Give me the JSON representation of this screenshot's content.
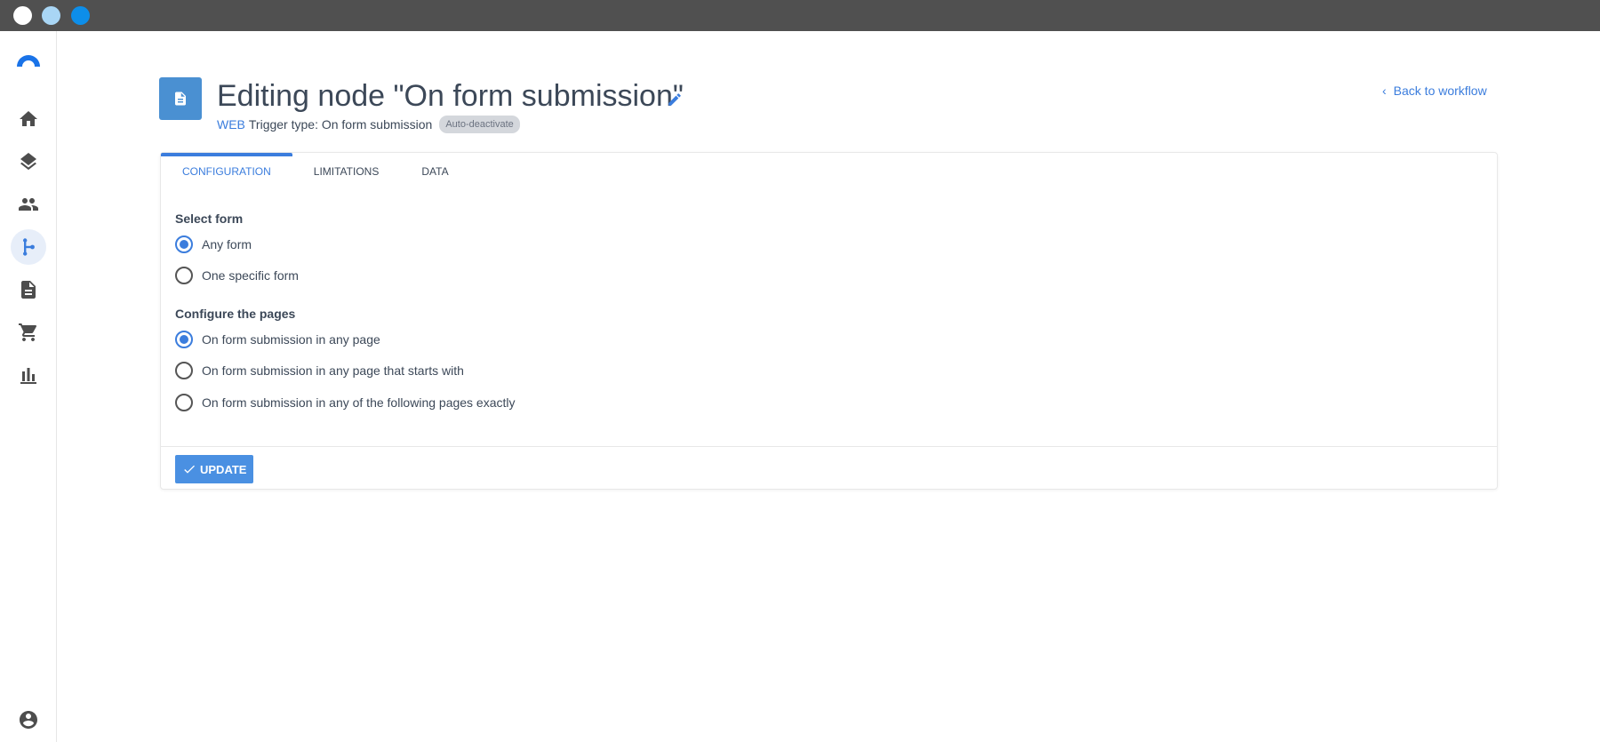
{
  "colors": {
    "titlebar": "#505050",
    "traffic_1": "#ffffff",
    "traffic_2": "#a9d6f5",
    "traffic_3": "#0d8ee9",
    "accent": "#3b7ddd",
    "node_icon_bg": "#4a90d2",
    "button_bg": "#4a90e2"
  },
  "sidebar": {
    "logo": "app-logo",
    "items": [
      {
        "icon": "home-icon",
        "active": false
      },
      {
        "icon": "layers-icon",
        "active": false
      },
      {
        "icon": "people-icon",
        "active": false
      },
      {
        "icon": "workflow-icon",
        "active": true
      },
      {
        "icon": "document-icon",
        "active": false
      },
      {
        "icon": "cart-icon",
        "active": false
      },
      {
        "icon": "bar-chart-icon",
        "active": false
      }
    ],
    "account_icon": "account-icon"
  },
  "header": {
    "icon": "document-icon",
    "title": "Editing node \"On form submission\"",
    "channel": "WEB",
    "trigger_type": "Trigger type: On form submission",
    "badge": "Auto-deactivate",
    "back_link": "Back to workflow"
  },
  "tabs": [
    {
      "label": "CONFIGURATION",
      "active": true
    },
    {
      "label": "LIMITATIONS",
      "active": false
    },
    {
      "label": "DATA",
      "active": false
    }
  ],
  "select_form": {
    "label": "Select form",
    "options": [
      {
        "label": "Any form",
        "checked": true
      },
      {
        "label": "One specific form",
        "checked": false
      }
    ]
  },
  "configure_pages": {
    "label": "Configure the pages",
    "options": [
      {
        "label": "On form submission in any page",
        "checked": true
      },
      {
        "label": "On form submission in any page that starts with",
        "checked": false
      },
      {
        "label": "On form submission in any of the following pages exactly",
        "checked": false
      }
    ]
  },
  "update_button": {
    "label": "UPDATE",
    "icon": "check-icon"
  }
}
